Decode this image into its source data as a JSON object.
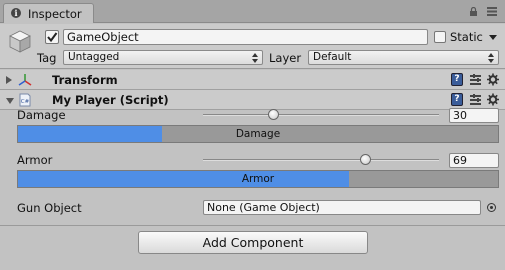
{
  "tab": {
    "title": "Inspector",
    "icon": "info-icon"
  },
  "gameobject": {
    "active": true,
    "name": "GameObject",
    "static_label": "Static",
    "static": false,
    "tag_label": "Tag",
    "tag_value": "Untagged",
    "layer_label": "Layer",
    "layer_value": "Default"
  },
  "components": [
    {
      "title": "Transform",
      "expanded": false,
      "icon": "transform-axes-icon"
    },
    {
      "title": "My Player (Script)",
      "expanded": true,
      "icon": "script-icon"
    }
  ],
  "script": {
    "damage": {
      "label": "Damage",
      "value": "30",
      "min": 0,
      "max": 100,
      "bar_label": "Damage",
      "bar_fraction": 0.3
    },
    "armor": {
      "label": "Armor",
      "value": "69",
      "min": 0,
      "max": 100,
      "bar_label": "Armor",
      "bar_fraction": 0.69
    },
    "gun": {
      "label": "Gun Object",
      "value": "None (Game Object)"
    }
  },
  "add_component_label": "Add Component",
  "colors": {
    "bar_fill": "#4f8ee6",
    "bar_bg": "#999999",
    "help_icon": "#3b5d9a"
  }
}
